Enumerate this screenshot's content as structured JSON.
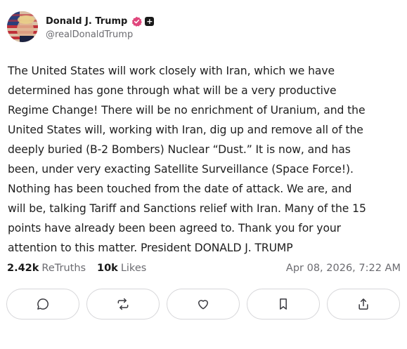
{
  "author": {
    "display_name": "Donald J. Trump",
    "handle": "@realDonaldTrump",
    "verified_color": "#e0467c",
    "avatar_icon": "profile-photo-flag"
  },
  "post": {
    "text": "The United States will work closely with Iran, which we have\ndetermined has gone through what will be a very productive\nRegime Change! There will be no enrichment of Uranium, and the\nUnited States will, working with Iran, dig up and remove all of the\ndeeply buried (B-2 Bombers) Nuclear “Dust.” It is now, and has\nbeen, under very exacting Satellite Surveillance (Space Force!).\nNothing has been touched from the date of attack. We are, and\nwill be, talking Tariff and Sanctions relief with Iran. Many of the 15\npoints have already been been agreed to. Thank you for your\nattention to this matter. President DONALD J. TRUMP"
  },
  "stats": {
    "retruths_count": "2.42k",
    "retruths_label": "ReTruths",
    "likes_count": "10k",
    "likes_label": "Likes",
    "timestamp": "Apr 08, 2026, 7:22 AM"
  },
  "actions": [
    {
      "name": "reply",
      "icon": "comment-icon"
    },
    {
      "name": "retruth",
      "icon": "repost-icon"
    },
    {
      "name": "like",
      "icon": "heart-icon"
    },
    {
      "name": "bookmark",
      "icon": "bookmark-icon"
    },
    {
      "name": "share",
      "icon": "share-icon"
    }
  ]
}
